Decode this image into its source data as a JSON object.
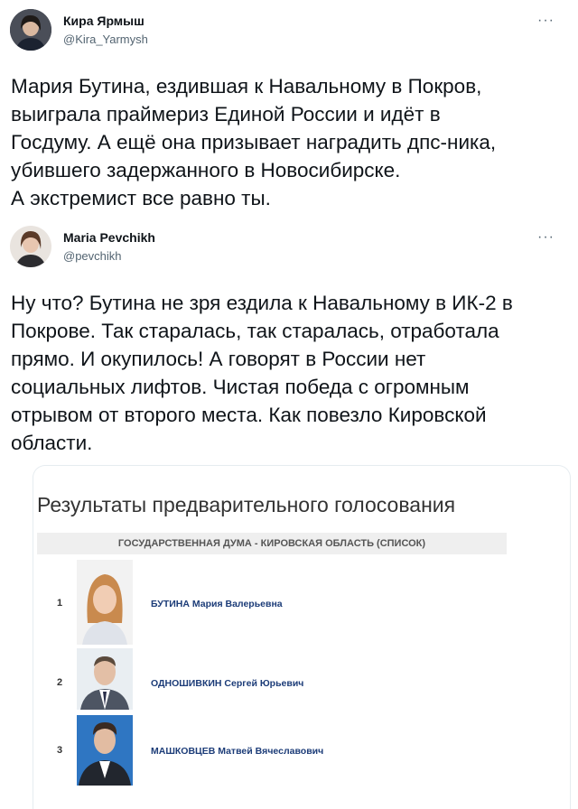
{
  "tweets": [
    {
      "author_name": "Кира Ярмыш",
      "author_handle": "@Kira_Yarmysh",
      "more": "···",
      "text": "Мария Бутина, ездившая к Навальному в Покров,\nвыиграла праймериз Единой России и идёт в\nГосдуму. А ещё она призывает наградить дпс-ника,\nубившего задержанного в Новосибирске.\nА экстремист все равно ты."
    },
    {
      "author_name": "Maria Pevchikh",
      "author_handle": "@pevchikh",
      "more": "···",
      "text": "Ну что?  Бутина не зря ездила к Навальному в ИК-2 в\nПокрове. Так старалась, так старалась, отработала\nпрямо. И окупилось! А говорят в России нет\nсоциальных лифтов. Чистая победа с огромным\nотрывом от второго места. Как повезло Кировской\nобласти."
    }
  ],
  "card": {
    "title": "Результаты предварительного голосования",
    "subtitle": "ГОСУДАРСТВЕННАЯ ДУМА - КИРОВСКАЯ ОБЛАСТЬ (СПИСОК)",
    "rows": [
      {
        "rank": "1",
        "surname": "БУТИНА",
        "given": "Мария Валерьевна"
      },
      {
        "rank": "2",
        "surname": "ОДНОШИВКИН",
        "given": "Сергей Юрьевич"
      },
      {
        "rank": "3",
        "surname": "МАШКОВЦЕВ",
        "given": "Матвей Вячеславович"
      }
    ],
    "colors": {
      "name_link": "#1c3c78",
      "subtitle_bg": "#efefef"
    }
  }
}
